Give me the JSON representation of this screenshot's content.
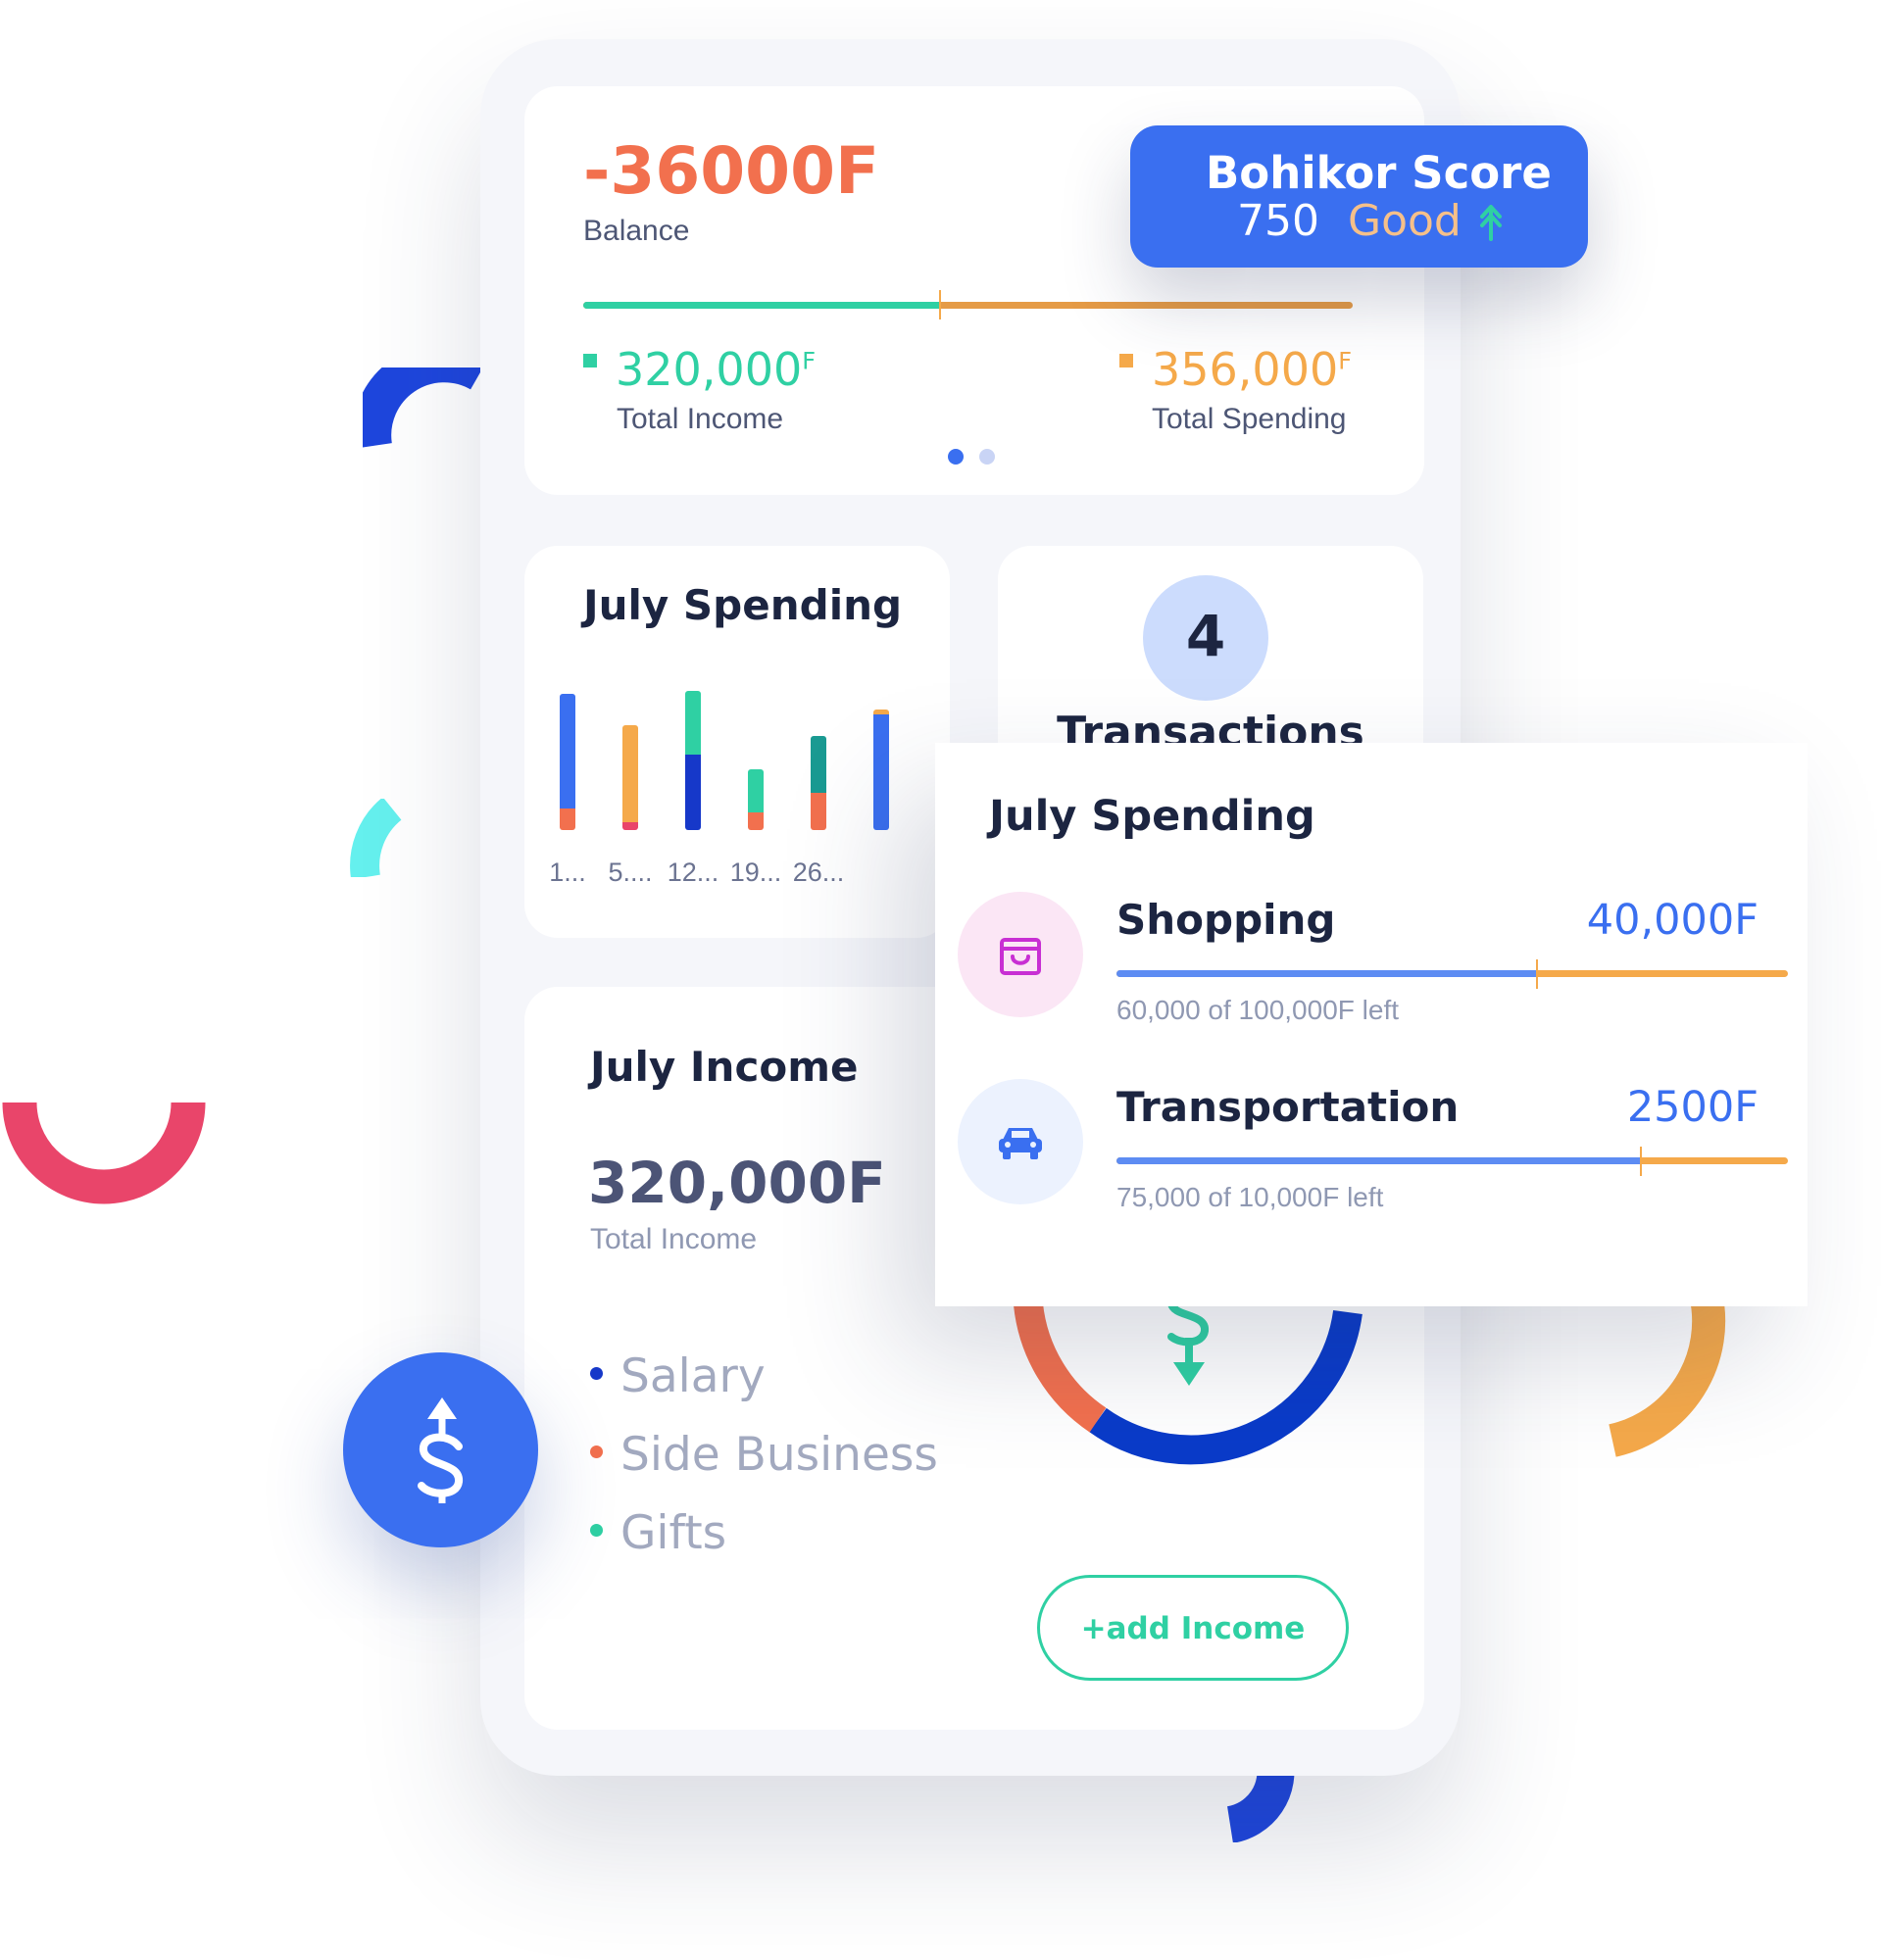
{
  "balance": {
    "amount": "-36000F",
    "label": "Balance",
    "income_value": "320,000",
    "income_sup": "F",
    "income_label": "Total Income",
    "spending_value": "356,000",
    "spending_sup": "F",
    "spending_label": "Total Spending",
    "income_share": 0.463,
    "pager": {
      "count": 2,
      "active": 1
    }
  },
  "score": {
    "title": "Bohikor Score",
    "value": "750",
    "rating": "Good",
    "trend": "up-arrow-icon"
  },
  "spending_chart": {
    "title": "July Spending"
  },
  "chart_data": {
    "type": "bar",
    "stacked": true,
    "categories": [
      "1...",
      "5....",
      "12...",
      "19...",
      "26..."
    ],
    "stacks": [
      [
        {
          "color": "#f2704e",
          "value": 14
        },
        {
          "color": "#3a6ff0",
          "value": 73
        }
      ],
      [
        {
          "color": "#e9456a",
          "value": 5
        },
        {
          "color": "#f5a94a",
          "value": 62
        }
      ],
      [
        {
          "color": "#1638c9",
          "value": 48
        },
        {
          "color": "#2fd0a3",
          "value": 41
        }
      ],
      [
        {
          "color": "#f2704e",
          "value": 11
        },
        {
          "color": "#2fd0a3",
          "value": 28
        }
      ],
      [
        {
          "color": "#f2704e",
          "value": 24
        },
        {
          "color": "#1a9a92",
          "value": 36
        }
      ],
      [
        {
          "color": "#3a6ff0",
          "value": 74
        },
        {
          "color": "#f5a94a",
          "value": 3
        }
      ]
    ],
    "grid": false,
    "legend": "none"
  },
  "transactions": {
    "count": "4",
    "label": "Transactions"
  },
  "popover": {
    "title": "July Spending",
    "items": [
      {
        "name": "Shopping",
        "amount": "40,000F",
        "left_text": "60,000 of 100,000F left",
        "progress": 0.625,
        "icon": "shopping-bag-icon"
      },
      {
        "name": "Transportation",
        "amount": "2500F",
        "left_text": "75,000 of 10,000F left",
        "progress": 0.78,
        "icon": "car-icon"
      }
    ]
  },
  "income": {
    "title": "July Income",
    "amount": "320,000F",
    "amount_label": "Total Income",
    "legend": [
      {
        "label": "Salary",
        "color": "#1638c9"
      },
      {
        "label": "Side Business",
        "color": "#f2704e"
      },
      {
        "label": "Gifts",
        "color": "#2fd0a3"
      }
    ],
    "add_button": "+add Income"
  },
  "colors": {
    "blue": "#3a6ff0",
    "teal": "#2fd0a3",
    "orange": "#f5a94a",
    "coral": "#f2704e",
    "navy": "#1638c9"
  }
}
